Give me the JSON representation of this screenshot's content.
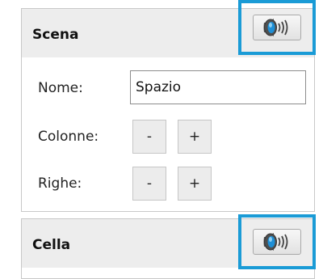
{
  "scena": {
    "title": "Scena",
    "speak_icon": "speaker-sound-icon",
    "name_label": "Nome:",
    "name_value": "Spazio",
    "columns_label": "Colonne:",
    "rows_label": "Righe:",
    "decrement_label": "-",
    "increment_label": "+"
  },
  "cella": {
    "title": "Cella",
    "speak_icon": "speaker-sound-icon"
  },
  "colors": {
    "highlight": "#1a9bd6",
    "header_bg": "#ededed"
  }
}
